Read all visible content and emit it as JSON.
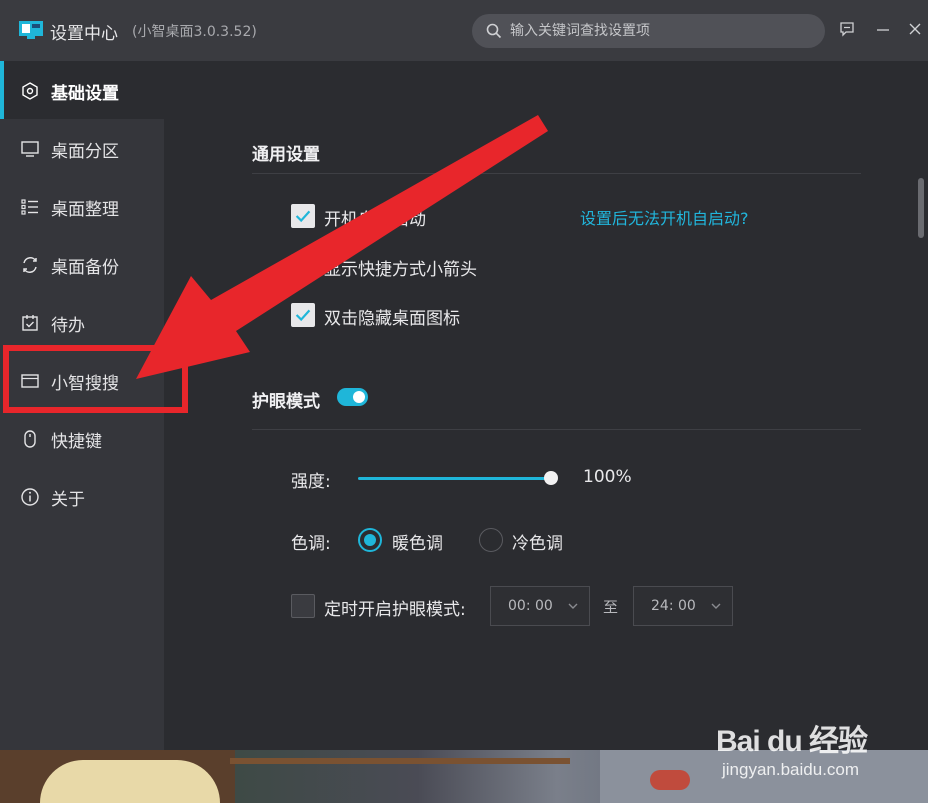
{
  "window": {
    "title": "设置中心",
    "version": "(小智桌面3.0.3.52)"
  },
  "search": {
    "placeholder": "输入关键词查找设置项"
  },
  "sidebar": {
    "items": [
      {
        "label": "基础设置",
        "icon": "settings-hex-icon",
        "active": true
      },
      {
        "label": "桌面分区",
        "icon": "monitor-icon",
        "active": false
      },
      {
        "label": "桌面整理",
        "icon": "list-icon",
        "active": false
      },
      {
        "label": "桌面备份",
        "icon": "sync-icon",
        "active": false
      },
      {
        "label": "待办",
        "icon": "calendar-check-icon",
        "active": false
      },
      {
        "label": "小智搜搜",
        "icon": "window-icon",
        "active": false
      },
      {
        "label": "快捷键",
        "icon": "mouse-icon",
        "active": false
      },
      {
        "label": "关于",
        "icon": "info-icon",
        "active": false
      }
    ]
  },
  "general": {
    "title": "通用设置",
    "options": [
      {
        "label": "开机自动启动",
        "checked": true
      },
      {
        "label": "显示快捷方式小箭头",
        "checked": false
      },
      {
        "label": "双击隐藏桌面图标",
        "checked": true
      }
    ],
    "help_link": "设置后无法开机自启动?"
  },
  "eye_care": {
    "title": "护眼模式",
    "enabled": true,
    "strength_label": "强度:",
    "strength_value": "100%",
    "strength_fraction": 1.0,
    "tone_label": "色调:",
    "tone_options": [
      {
        "label": "暖色调",
        "selected": true
      },
      {
        "label": "冷色调",
        "selected": false
      }
    ],
    "schedule_label": "定时开启护眼模式:",
    "schedule_checked": false,
    "start_time": "00: 00",
    "to_label": "至",
    "end_time": "24: 00"
  },
  "watermark": {
    "brand": "Bai du 经验",
    "url": "jingyan.baidu.com"
  },
  "colors": {
    "accent": "#1fb6d9",
    "annotation": "#e8262b"
  }
}
